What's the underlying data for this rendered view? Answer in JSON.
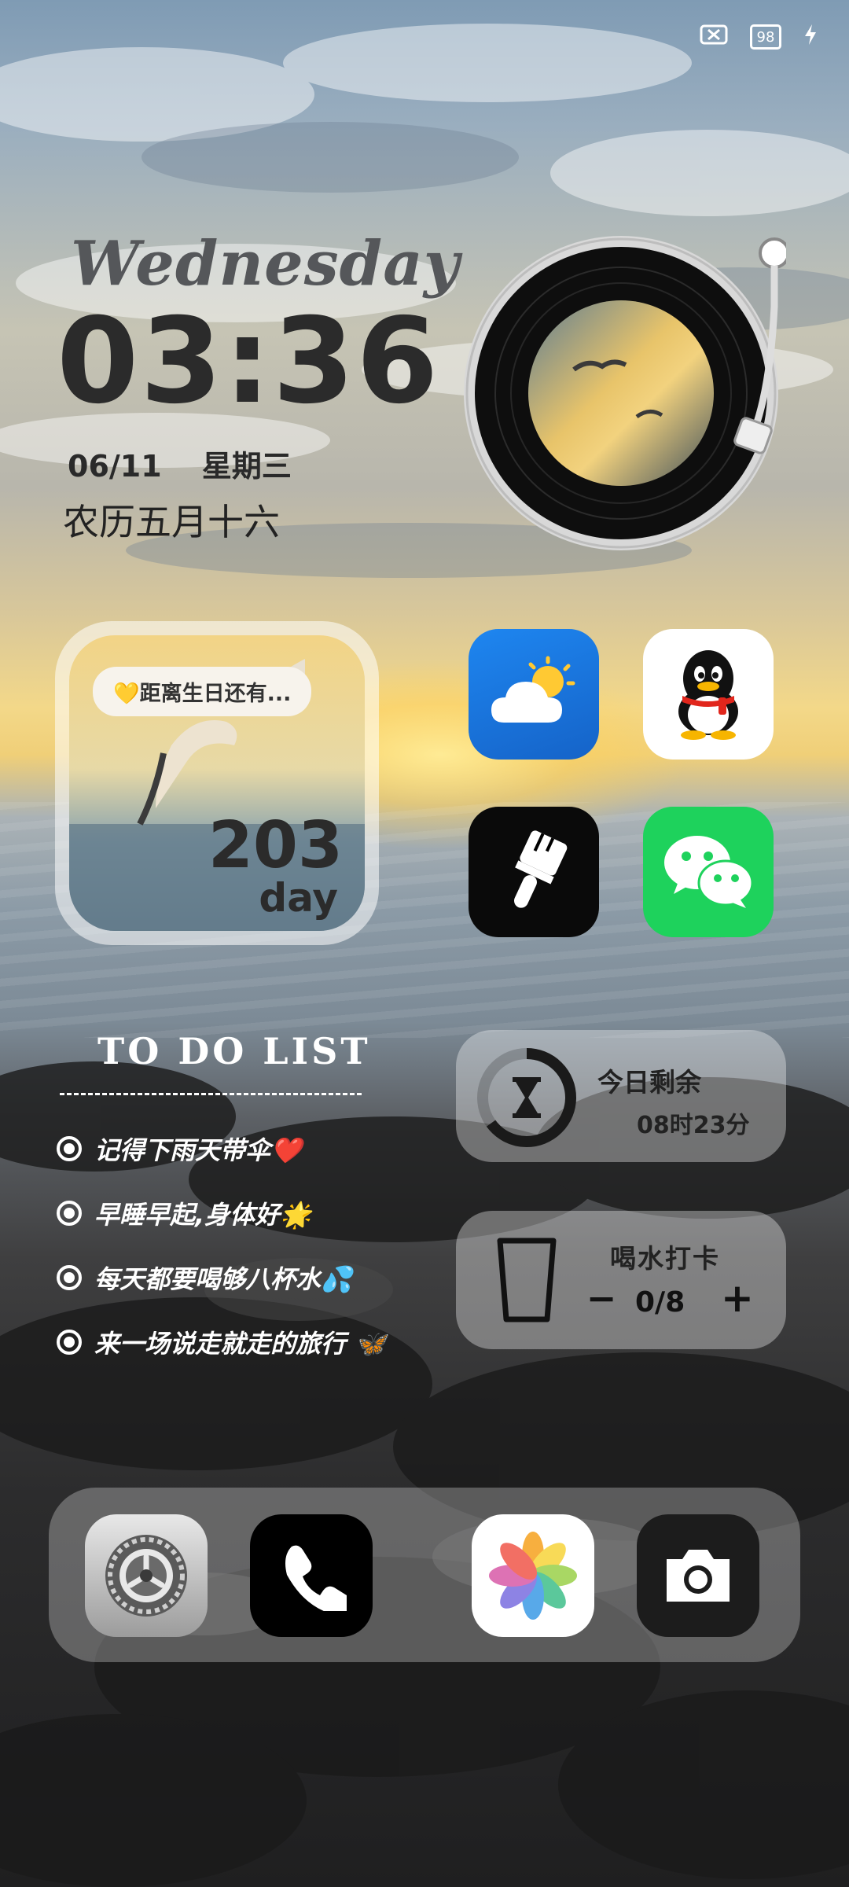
{
  "status_bar": {
    "battery": "98"
  },
  "clock_widget": {
    "weekday": "Wednesday",
    "time": "03:36",
    "date": "06/11",
    "weekday_cn": "星期三",
    "lunar": "农历五月十六"
  },
  "countdown_widget": {
    "caption": "💛距离生日还有...",
    "number": "203",
    "unit": "day"
  },
  "apps": [
    {
      "name": "Weather",
      "icon": "weather-icon"
    },
    {
      "name": "QQ",
      "icon": "qq-penguin-icon"
    },
    {
      "name": "Themes",
      "icon": "paintbrush-icon"
    },
    {
      "name": "WeChat",
      "icon": "wechat-icon"
    }
  ],
  "todo": {
    "title": "TO DO LIST",
    "items": [
      "记得下雨天带伞❤️",
      "早睡早起,身体好🌟",
      "每天都要喝够八杯水💦",
      "来一场说走就走的旅行 🦋"
    ]
  },
  "remaining_widget": {
    "label": "今日剩余",
    "value": "08时23分",
    "progress": 0.65
  },
  "water_widget": {
    "label": "喝水打卡",
    "minus": "−",
    "count": "0/8",
    "plus": "+"
  },
  "dock": [
    {
      "name": "Settings",
      "icon": "settings-gear-icon"
    },
    {
      "name": "Phone",
      "icon": "phone-icon"
    },
    {
      "name": "Photos",
      "icon": "photos-flower-icon"
    },
    {
      "name": "Camera",
      "icon": "camera-icon"
    }
  ]
}
